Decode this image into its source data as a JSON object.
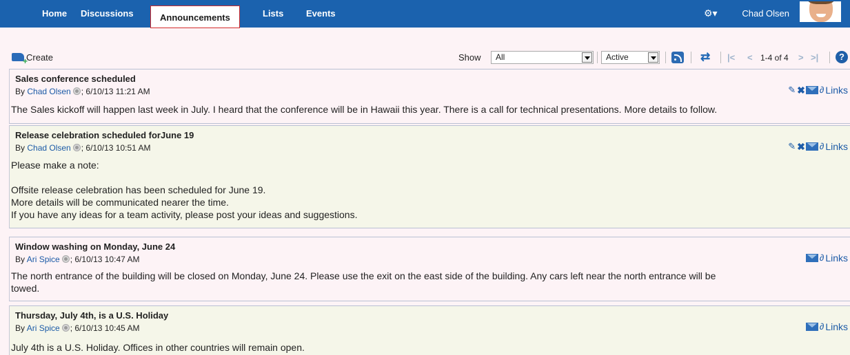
{
  "nav": {
    "tabs": [
      "Home",
      "Discussions",
      "Announcements",
      "Lists",
      "Events"
    ],
    "active_tab": "Announcements",
    "user_name": "Chad Olsen",
    "settings_icon": "gear-icon"
  },
  "toolbar": {
    "create_label": "Create",
    "show_label": "Show",
    "show_value": "All",
    "status_value": "Active",
    "pager_text": "1-4 of 4",
    "help_label": "?"
  },
  "announcements": [
    {
      "title": "Sales conference scheduled",
      "by": "By",
      "author": "Chad Olsen",
      "date": "; 6/10/13 11:21 AM",
      "body": "The Sales kickoff will happen last week in July. I heard that the conference will be in Hawaii this year. There is a call for technical presentations. More details to follow.",
      "links_label": "Links"
    },
    {
      "title": "Release celebration scheduled forJune 19",
      "by": "By",
      "author": "Chad Olsen",
      "date": "; 6/10/13 10:51 AM",
      "body": "Please make a note:\n\nOffsite release celebration has been scheduled for June 19.\nMore details will be communicated nearer the time.\nIf you have any ideas for a team activity, please post your ideas and suggestions.",
      "links_label": "Links"
    },
    {
      "title": "Window washing on Monday, June 24",
      "by": "By",
      "author": "Ari Spice",
      "date": "; 6/10/13 10:47 AM",
      "body": "The north entrance of the building will be closed on Monday, June 24. Please use the exit on the east side of the building. Any cars left near the north entrance will be\ntowed.",
      "links_label": "Links"
    },
    {
      "title": "Thursday, July 4th, is a U.S. Holiday",
      "by": "By",
      "author": "Ari Spice",
      "date": "; 6/10/13 10:45 AM",
      "body": "July 4th is a U.S. Holiday. Offices in other countries will remain open.",
      "links_label": "Links"
    }
  ],
  "colors": {
    "nav_bg": "#1b62ae",
    "page_bg": "#fdf3f6",
    "alt_row_bg": "#f5f6e9",
    "link": "#1b5aa6",
    "active_tab_border": "#d42a2a"
  }
}
